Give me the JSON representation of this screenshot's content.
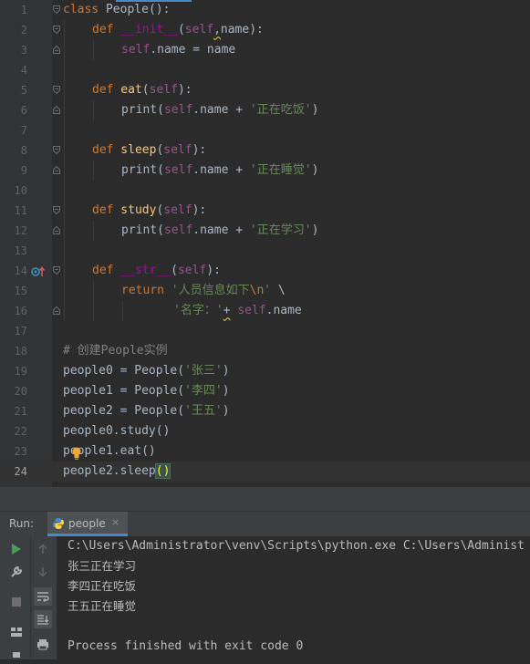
{
  "editor": {
    "current_line": 24,
    "lines": [
      {
        "n": "1"
      },
      {
        "n": "2"
      },
      {
        "n": "3"
      },
      {
        "n": "4"
      },
      {
        "n": "5"
      },
      {
        "n": "6"
      },
      {
        "n": "7"
      },
      {
        "n": "8"
      },
      {
        "n": "9"
      },
      {
        "n": "10"
      },
      {
        "n": "11"
      },
      {
        "n": "12"
      },
      {
        "n": "13"
      },
      {
        "n": "14"
      },
      {
        "n": "15"
      },
      {
        "n": "16"
      },
      {
        "n": "17"
      },
      {
        "n": "18"
      },
      {
        "n": "19"
      },
      {
        "n": "20"
      },
      {
        "n": "21"
      },
      {
        "n": "22"
      },
      {
        "n": "23"
      },
      {
        "n": "24"
      }
    ],
    "tokens": {
      "l1": [
        "class",
        " People",
        "():"
      ],
      "l2": [
        "def",
        " __init__",
        "(",
        "self",
        ",",
        "name",
        "):"
      ],
      "l3": [
        "self",
        ".name = name"
      ],
      "l5": [
        "def",
        " eat",
        "(",
        "self",
        "):"
      ],
      "l6": [
        "print",
        "(",
        "self",
        ".name + ",
        "'正在吃饭'",
        ")"
      ],
      "l8": [
        "def",
        " sleep",
        "(",
        "self",
        "):"
      ],
      "l9": [
        "print",
        "(",
        "self",
        ".name + ",
        "'正在睡觉'",
        ")"
      ],
      "l11": [
        "def",
        " study",
        "(",
        "self",
        "):"
      ],
      "l12": [
        "print",
        "(",
        "self",
        ".name + ",
        "'正在学习'",
        ")"
      ],
      "l14": [
        "def",
        " __str__",
        "(",
        "self",
        "):"
      ],
      "l15": [
        "return",
        " ",
        "'人员信息如下",
        "\\n",
        "'",
        " \\"
      ],
      "l16": [
        "'名字：'",
        "+",
        " ",
        "self",
        ".name"
      ],
      "l18": [
        "# 创建People实例"
      ],
      "l19": [
        "people0 = People(",
        "'张三'",
        ")"
      ],
      "l20": [
        "people1 = People(",
        "'李四'",
        ")"
      ],
      "l21": [
        "people2 = People(",
        "'王五'",
        ")"
      ],
      "l22": [
        "people0.study()"
      ],
      "l23": [
        "people1.eat()"
      ],
      "l24": [
        "people2.sleep",
        "()"
      ]
    }
  },
  "run_panel": {
    "label": "Run:",
    "tab_name": "people",
    "tab_close": "×",
    "console_lines": [
      "C:\\Users\\Administrator\\venv\\Scripts\\python.exe C:\\Users\\Administ",
      "张三正在学习",
      "李四正在吃饭",
      "王五正在睡觉",
      "",
      "Process finished with exit code 0"
    ]
  },
  "colors": {
    "editor_bg": "#2b2b2b",
    "gutter_bg": "#313335",
    "keyword": "#cc7832",
    "function": "#ffc66d",
    "self": "#94558d",
    "string": "#6a8759",
    "comment": "#808080",
    "run_green": "#499c54"
  }
}
